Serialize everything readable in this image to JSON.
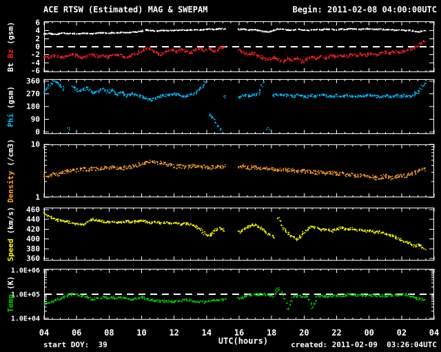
{
  "header": {
    "title": "ACE RTSW (Estimated) MAG & SWEPAM",
    "begin": "Begin: 2011-02-08 04:00:00UTC"
  },
  "footer": {
    "start_doy": "start DOY:  39",
    "created": "created: 2011-02-09  03:26:04UTC"
  },
  "colors": {
    "background": "#000000",
    "frame": "#ffffff",
    "bt": "#ffffff",
    "bz": "#ff2020",
    "phi": "#00bfff",
    "density": "#ffa030",
    "speed": "#ffff00",
    "temp": "#00d000"
  },
  "chart_data": {
    "type": "scatter",
    "title": "ACE RTSW (Estimated) MAG & SWEPAM",
    "begin_time": "2011-02-08 04:00:00UTC",
    "grid": false,
    "legend": "none",
    "background": "#000000",
    "x": {
      "label": "UTC(hours)",
      "start_offset_hours": 0,
      "step_hours": 0.3,
      "range_hours": [
        0,
        24
      ],
      "tick_offsets": [
        0,
        2,
        4,
        6,
        8,
        10,
        12,
        14,
        16,
        18,
        20,
        22,
        24
      ],
      "tick_labels": [
        "04",
        "06",
        "08",
        "10",
        "12",
        "14",
        "16",
        "18",
        "20",
        "22",
        "00",
        "02",
        "04"
      ]
    },
    "panels": [
      {
        "name": "bt_bz",
        "ylabel_parts": [
          {
            "text": "Bt",
            "color": "#ffffff"
          },
          {
            "text": "Bz",
            "color": "#ff2020"
          },
          {
            "text": "(gsm)",
            "color": "#ffffff"
          }
        ],
        "yscale": "linear",
        "ylim": [
          -6,
          6
        ],
        "yticks": [
          {
            "label": "6",
            "value": 6
          },
          {
            "label": "4",
            "value": 4
          },
          {
            "label": "2",
            "value": 2
          },
          {
            "label": "0",
            "value": 0
          },
          {
            "label": "-2",
            "value": -2
          },
          {
            "label": "-4",
            "value": -4
          },
          {
            "label": "-6",
            "value": -6
          }
        ],
        "dashed_at": [
          0
        ],
        "series": [
          {
            "name": "Bt",
            "color": "#ffffff",
            "values": [
              3.2,
              3.3,
              3.1,
              3.2,
              3.4,
              3.2,
              3.3,
              3.2,
              3.4,
              3.3,
              3.2,
              3.4,
              3.5,
              3.3,
              3.5,
              3.4,
              3.6,
              3.5,
              3.6,
              3.7,
              3.9,
              4.2,
              4.0,
              3.9,
              4.0,
              4.1,
              4.0,
              4.1,
              4.2,
              4.1,
              4.2,
              4.3,
              4.2,
              4.3,
              4.4,
              4.3,
              4.5,
              4.4,
              null,
              null,
              4.3,
              4.4,
              4.2,
              4.3,
              4.1,
              3.8,
              3.7,
              4.0,
              4.4,
              4.3,
              4.2,
              4.1,
              4.3,
              4.2,
              4.1,
              4.2,
              4.3,
              4.2,
              4.4,
              4.3,
              4.2,
              4.4,
              4.3,
              4.5,
              4.4,
              4.3,
              4.5,
              4.4,
              4.3,
              4.4,
              4.2,
              4.3,
              4.1,
              4.2,
              4.0,
              4.1,
              3.8,
              3.7,
              4.0
            ]
          },
          {
            "name": "Bz",
            "color": "#ff2020",
            "values": [
              -2.3,
              -2.7,
              -2.1,
              -2.5,
              -2.8,
              -2.2,
              -1.8,
              -2.4,
              -2.9,
              -2.3,
              -1.9,
              -2.5,
              -2.2,
              -2.7,
              -2.1,
              -1.8,
              -2.4,
              -2.8,
              -2.2,
              -1.6,
              -1.0,
              -0.4,
              -0.9,
              -1.5,
              -2.0,
              -1.3,
              -0.7,
              -1.2,
              -0.6,
              -1.1,
              -1.6,
              -0.8,
              -0.4,
              -1.0,
              -0.5,
              -1.2,
              -0.3,
              -0.2,
              null,
              null,
              -0.8,
              -1.4,
              -2.0,
              -1.5,
              -2.3,
              -2.8,
              -3.3,
              -2.6,
              -3.1,
              -3.6,
              -2.9,
              -3.4,
              -2.7,
              -3.8,
              -3.1,
              -2.5,
              -3.0,
              -2.4,
              -2.8,
              -2.2,
              -2.6,
              -2.1,
              -2.5,
              -1.9,
              -2.3,
              -1.8,
              -2.2,
              -1.7,
              -2.1,
              -1.6,
              -1.3,
              -1.7,
              -1.2,
              -1.5,
              -1.0,
              -0.7,
              -0.3,
              0.6,
              1.5
            ]
          }
        ]
      },
      {
        "name": "phi",
        "ylabel_parts": [
          {
            "text": "Phi",
            "color": "#00bfff"
          },
          {
            "text": "(gsm)",
            "color": "#ffffff"
          }
        ],
        "yscale": "linear",
        "ylim": [
          0,
          360
        ],
        "yticks": [
          {
            "label": "360",
            "value": 360
          },
          {
            "label": "270",
            "value": 270
          },
          {
            "label": "180",
            "value": 180
          },
          {
            "label": "90",
            "value": 90
          },
          {
            "label": "0",
            "value": 0
          }
        ],
        "dashed_at": [],
        "series": [
          {
            "name": "Phi",
            "color": "#00bfff",
            "values": [
              280,
              330,
              355,
              345,
              300,
              20,
              320,
              290,
              300,
              310,
              275,
              285,
              310,
              280,
              295,
              265,
              280,
              255,
              270,
              260,
              250,
              235,
              225,
              240,
              255,
              260,
              265,
              270,
              258,
              252,
              262,
              275,
              305,
              355,
              120,
              90,
              20,
              250,
              null,
              null,
              245,
              258,
              250,
              262,
              270,
              355,
              25,
              255,
              265,
              256,
              262,
              250,
              260,
              253,
              247,
              258,
              251,
              263,
              255,
              248,
              258,
              250,
              262,
              254,
              247,
              259,
              252,
              261,
              255,
              247,
              257,
              250,
              260,
              252,
              258,
              250,
              268,
              290,
              340
            ]
          }
        ]
      },
      {
        "name": "density",
        "ylabel_parts": [
          {
            "text": "Density",
            "color": "#ffa030"
          },
          {
            "text": "(/cm3)",
            "color": "#ffffff"
          }
        ],
        "yscale": "log",
        "ylim": [
          1,
          10
        ],
        "yticks": [
          {
            "label": "10",
            "value": 10
          },
          {
            "label": "1",
            "value": 1
          }
        ],
        "dashed_at": [],
        "series": [
          {
            "name": "Density",
            "color": "#ffa030",
            "values": [
              2.6,
              2.5,
              2.8,
              2.7,
              3.0,
              3.1,
              3.3,
              3.2,
              3.4,
              3.3,
              3.5,
              3.4,
              3.6,
              3.5,
              3.7,
              3.6,
              3.5,
              3.7,
              3.8,
              4.0,
              4.3,
              4.6,
              4.8,
              4.6,
              4.4,
              4.2,
              4.0,
              3.8,
              3.9,
              3.7,
              3.8,
              3.9,
              3.7,
              3.8,
              3.6,
              3.8,
              3.7,
              3.9,
              null,
              null,
              3.7,
              3.8,
              3.6,
              3.7,
              3.5,
              3.6,
              3.4,
              3.5,
              3.3,
              3.4,
              3.2,
              3.3,
              3.1,
              3.2,
              3.0,
              3.1,
              2.9,
              3.0,
              2.8,
              2.9,
              2.7,
              2.8,
              2.6,
              2.7,
              2.5,
              2.6,
              2.4,
              2.5,
              2.3,
              2.4,
              2.5,
              2.3,
              2.4,
              2.6,
              2.5,
              2.7,
              2.9,
              3.2,
              3.4
            ]
          }
        ]
      },
      {
        "name": "speed",
        "ylabel_parts": [
          {
            "text": "Speed",
            "color": "#ffff00"
          },
          {
            "text": "(km/s)",
            "color": "#ffffff"
          }
        ],
        "yscale": "linear",
        "ylim": [
          360,
          460
        ],
        "yticks": [
          {
            "label": "460",
            "value": 460
          },
          {
            "label": "440",
            "value": 440
          },
          {
            "label": "420",
            "value": 420
          },
          {
            "label": "400",
            "value": 400
          },
          {
            "label": "380",
            "value": 380
          },
          {
            "label": "360",
            "value": 360
          }
        ],
        "dashed_at": [],
        "series": [
          {
            "name": "Speed",
            "color": "#ffff00",
            "values": [
              452,
              446,
              441,
              438,
              437,
              435,
              433,
              430,
              428,
              434,
              441,
              438,
              436,
              434,
              436,
              433,
              435,
              437,
              434,
              436,
              438,
              435,
              433,
              435,
              432,
              434,
              431,
              433,
              430,
              432,
              429,
              426,
              420,
              410,
              406,
              417,
              422,
              418,
              null,
              null,
              414,
              420,
              426,
              430,
              425,
              418,
              410,
              404,
              443,
              421,
              412,
              404,
              398,
              410,
              420,
              426,
              422,
              418,
              421,
              416,
              420,
              423,
              419,
              421,
              417,
              419,
              415,
              417,
              413,
              415,
              411,
              408,
              404,
              399,
              394,
              391,
              385,
              389,
              380
            ]
          }
        ]
      },
      {
        "name": "temp",
        "ylabel_parts": [
          {
            "text": "Temp",
            "color": "#00d000"
          },
          {
            "text": "(K)",
            "color": "#ffffff"
          }
        ],
        "yscale": "log",
        "ylim": [
          10000,
          1000000
        ],
        "yticks": [
          {
            "label": "1.0E+06",
            "value": 1000000
          },
          {
            "label": "1.0E+05",
            "value": 100000
          },
          {
            "label": "1.0E+04",
            "value": 10000
          }
        ],
        "dashed_at": [
          100000
        ],
        "series": [
          {
            "name": "Temp",
            "color": "#00d000",
            "values": [
              40000,
              45000,
              52000,
              62000,
              75000,
              90000,
              100000,
              95000,
              85000,
              72000,
              62000,
              68000,
              75000,
              71000,
              73000,
              69000,
              71000,
              64000,
              61000,
              67000,
              74000,
              66000,
              57000,
              52000,
              50000,
              52000,
              48000,
              50000,
              53000,
              62000,
              56000,
              51000,
              48000,
              46000,
              50000,
              55000,
              58000,
              60000,
              null,
              null,
              65000,
              75000,
              90000,
              100000,
              95000,
              104000,
              90000,
              81000,
              180000,
              95000,
              26000,
              78000,
              85000,
              76000,
              80000,
              28000,
              83000,
              87000,
              80000,
              85000,
              90000,
              84000,
              93000,
              100000,
              88000,
              92000,
              86000,
              90000,
              85000,
              88000,
              83000,
              87000,
              90000,
              95000,
              100000,
              88000,
              70000,
              63000,
              60000
            ]
          }
        ]
      }
    ]
  }
}
